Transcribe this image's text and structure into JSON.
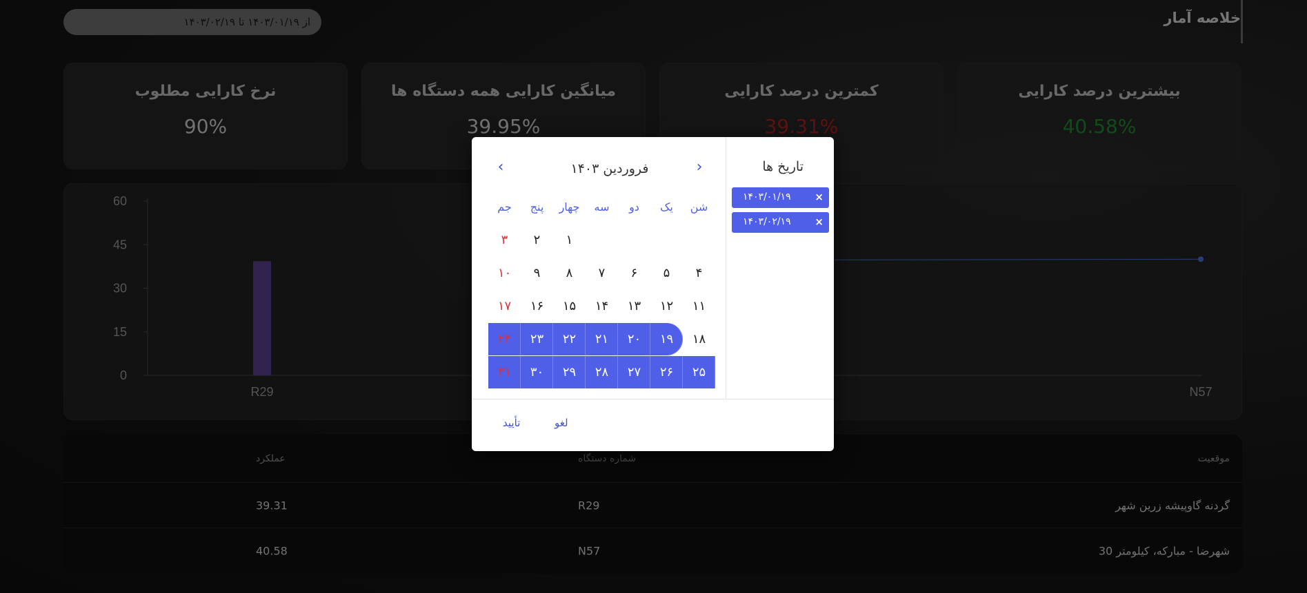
{
  "header": {
    "title": "خلاصه آمار",
    "date_range": "از ۱۴۰۳/۰۱/۱۹ تا ۱۴۰۳/۰۲/۱۹"
  },
  "stats": [
    {
      "label": "بیشترین درصد کارایی",
      "value": "40.58%",
      "color": "#1e8a2e"
    },
    {
      "label": "کمترین درصد کارایی",
      "value": "39.31%",
      "color": "#b02020"
    },
    {
      "label": "میانگین کارایی همه دستگاه ها",
      "value": "39.95%",
      "color": "#bdbdbd"
    },
    {
      "label": "نرخ کارایی مطلوب",
      "value": "90%",
      "color": "#bdbdbd"
    }
  ],
  "chart_data": {
    "type": "bar",
    "categories": [
      "R29",
      "N57"
    ],
    "values": [
      39.31,
      40.58
    ],
    "target_series": {
      "name": "",
      "values": [
        40,
        40
      ]
    },
    "yticks": [
      0,
      15,
      30,
      45,
      60
    ],
    "ylim": [
      0,
      60
    ],
    "bar_color": "#5a3f8f",
    "line_color": "#4a6fd8"
  },
  "table": {
    "headers": {
      "location": "موقعیت",
      "device": "شماره دستگاه",
      "performance": "عملکرد"
    },
    "rows": [
      {
        "location": "گردنه گاوپیشه زرین شهر",
        "device": "R29",
        "performance": "39.31"
      },
      {
        "location": "شهرضا - مبارکه، کیلومتر 30",
        "device": "N57",
        "performance": "40.58"
      }
    ]
  },
  "dialog": {
    "sidebar_title": "تاریخ ها",
    "chips": [
      {
        "text": "۱۴۰۳/۰۱/۱۹",
        "remove": "×"
      },
      {
        "text": "۱۴۰۳/۰۲/۱۹",
        "remove": "×"
      }
    ],
    "month_title": "فروردین ۱۴۰۳",
    "weekdays": [
      "شن",
      "یک",
      "دو",
      "سه",
      "چهار",
      "پنج",
      "جم"
    ],
    "days": [
      [
        "",
        "",
        "",
        "",
        "۱",
        "۲",
        "۳"
      ],
      [
        "۴",
        "۵",
        "۶",
        "۷",
        "۸",
        "۹",
        "۱۰"
      ],
      [
        "۱۱",
        "۱۲",
        "۱۳",
        "۱۴",
        "۱۵",
        "۱۶",
        "۱۷"
      ],
      [
        "۱۸",
        "۱۹",
        "۲۰",
        "۲۱",
        "۲۲",
        "۲۳",
        "۲۴"
      ],
      [
        "۲۵",
        "۲۶",
        "۲۷",
        "۲۸",
        "۲۹",
        "۳۰",
        "۳۱"
      ]
    ],
    "selected_from_day": 19,
    "confirm_label": "تأیید",
    "cancel_label": "لغو",
    "nav_prev": "‹",
    "nav_next": "›"
  },
  "colors": {
    "accent": "#4f5fe8",
    "weekend": "#e0303a"
  }
}
